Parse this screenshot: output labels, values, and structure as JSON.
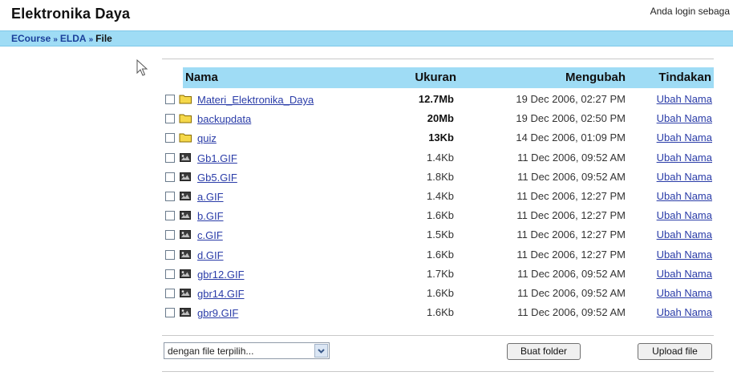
{
  "header": {
    "title": "Elektronika Daya",
    "login_text": "Anda login sebaga"
  },
  "breadcrumb": {
    "items": [
      "ECourse",
      "ELDA"
    ],
    "separator": "»",
    "current": "File"
  },
  "table": {
    "headers": {
      "name": "Nama",
      "size": "Ukuran",
      "modified": "Mengubah",
      "action": "Tindakan"
    },
    "rows": [
      {
        "type": "folder",
        "name": "Materi_Elektronika_Daya",
        "size": "12.7Mb",
        "modified": "19 Dec 2006, 02:27 PM",
        "action": "Ubah Nama",
        "checked": false
      },
      {
        "type": "folder",
        "name": "backupdata",
        "size": "20Mb",
        "modified": "19 Dec 2006, 02:50 PM",
        "action": "Ubah Nama",
        "checked": false
      },
      {
        "type": "folder",
        "name": "quiz",
        "size": "13Kb",
        "modified": "14 Dec 2006, 01:09 PM",
        "action": "Ubah Nama",
        "checked": false
      },
      {
        "type": "image",
        "name": "Gb1.GIF",
        "size": "1.4Kb",
        "modified": "11 Dec 2006, 09:52 AM",
        "action": "Ubah Nama",
        "checked": false
      },
      {
        "type": "image",
        "name": "Gb5.GIF",
        "size": "1.8Kb",
        "modified": "11 Dec 2006, 09:52 AM",
        "action": "Ubah Nama",
        "checked": false
      },
      {
        "type": "image",
        "name": "a.GIF",
        "size": "1.4Kb",
        "modified": "11 Dec 2006, 12:27 PM",
        "action": "Ubah Nama",
        "checked": false
      },
      {
        "type": "image",
        "name": "b.GIF",
        "size": "1.6Kb",
        "modified": "11 Dec 2006, 12:27 PM",
        "action": "Ubah Nama",
        "checked": false
      },
      {
        "type": "image",
        "name": "c.GIF",
        "size": "1.5Kb",
        "modified": "11 Dec 2006, 12:27 PM",
        "action": "Ubah Nama",
        "checked": false
      },
      {
        "type": "image",
        "name": "d.GIF",
        "size": "1.6Kb",
        "modified": "11 Dec 2006, 12:27 PM",
        "action": "Ubah Nama",
        "checked": false
      },
      {
        "type": "image",
        "name": "gbr12.GIF",
        "size": "1.7Kb",
        "modified": "11 Dec 2006, 09:52 AM",
        "action": "Ubah Nama",
        "checked": false
      },
      {
        "type": "image",
        "name": "gbr14.GIF",
        "size": "1.6Kb",
        "modified": "11 Dec 2006, 09:52 AM",
        "action": "Ubah Nama",
        "checked": false
      },
      {
        "type": "image",
        "name": "gbr9.GIF",
        "size": "1.6Kb",
        "modified": "11 Dec 2006, 09:52 AM",
        "action": "Ubah Nama",
        "checked": false
      }
    ]
  },
  "actions": {
    "with_selected_placeholder": "dengan file terpilih...",
    "create_folder_label": "Buat folder",
    "upload_label": "Upload file"
  },
  "colors": {
    "nav_bar": "#9fdcf5",
    "link": "#2a3ca8",
    "folder_yellow": "#f5d84a"
  },
  "icons": {
    "folder": "folder-icon",
    "image": "image-file-icon",
    "cursor": "mouse-pointer-icon",
    "dropdown": "chevron-down-icon"
  }
}
